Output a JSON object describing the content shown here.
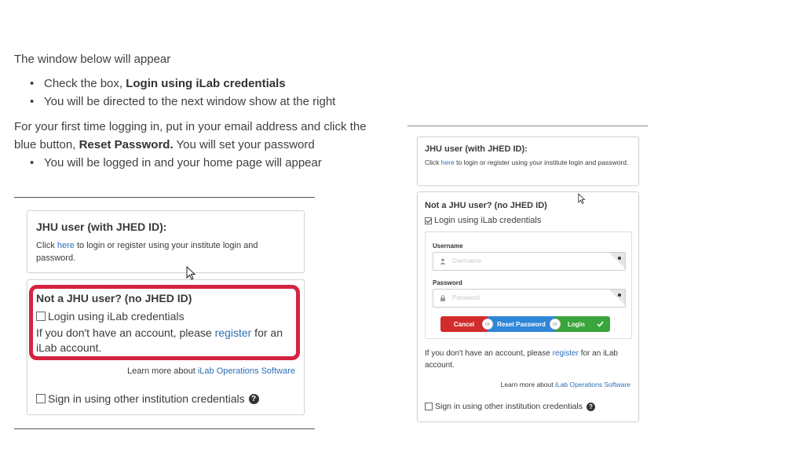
{
  "instructions": {
    "intro": "The window below will appear",
    "bullet1_prefix": "Check the box, ",
    "bullet1_bold": "Login using iLab credentials",
    "bullet2": "You will be directed to the next window show at the right",
    "para_prefix": "For your first time logging in, put in your email address and click the blue button, ",
    "para_bold": "Reset Password.",
    "para_suffix": " You will set your password",
    "bullet3": "You will be logged in and your home page will appear"
  },
  "left_screenshot": {
    "jhu_title": "JHU user (with JHED ID):",
    "jhu_click": "Click ",
    "jhu_here": "here",
    "jhu_desc": " to login or register using your institute login and password.",
    "not_jhu_title": "Not a JHU user? (no JHED ID)",
    "login_checkbox_label": "Login using iLab credentials",
    "login_checked": false,
    "acct_prefix": "If you don't have an account, please ",
    "acct_register": "register",
    "acct_suffix": " for an iLab account.",
    "learn_prefix": "Learn more about ",
    "learn_link": "iLab Operations Software",
    "other_inst_label": "Sign in using other institution credentials",
    "highlight_color": "#d42340"
  },
  "right_screenshot": {
    "jhu_title": "JHU user (with JHED ID):",
    "jhu_click": "Click ",
    "jhu_here": "here",
    "jhu_desc": " to login or register using your institute login and password.",
    "not_jhu_title": "Not a JHU user? (no JHED ID)",
    "login_checkbox_label": "Login using iLab credentials",
    "login_checked": true,
    "username_label": "Username",
    "username_placeholder": "Username",
    "password_label": "Password",
    "password_placeholder": "Password",
    "cancel_label": "Cancel",
    "or_label": "or",
    "reset_label": "Reset Password",
    "login_label": "Login",
    "acct_prefix": "If you don't have an account, please ",
    "acct_register": "register",
    "acct_suffix": " for an iLab account.",
    "learn_prefix": "Learn more about ",
    "learn_link": "iLab Operations Software",
    "other_inst_label": "Sign in using other institution credentials",
    "colors": {
      "cancel": "#d32c2c",
      "reset": "#2f86d6",
      "login": "#3aa53a"
    }
  }
}
